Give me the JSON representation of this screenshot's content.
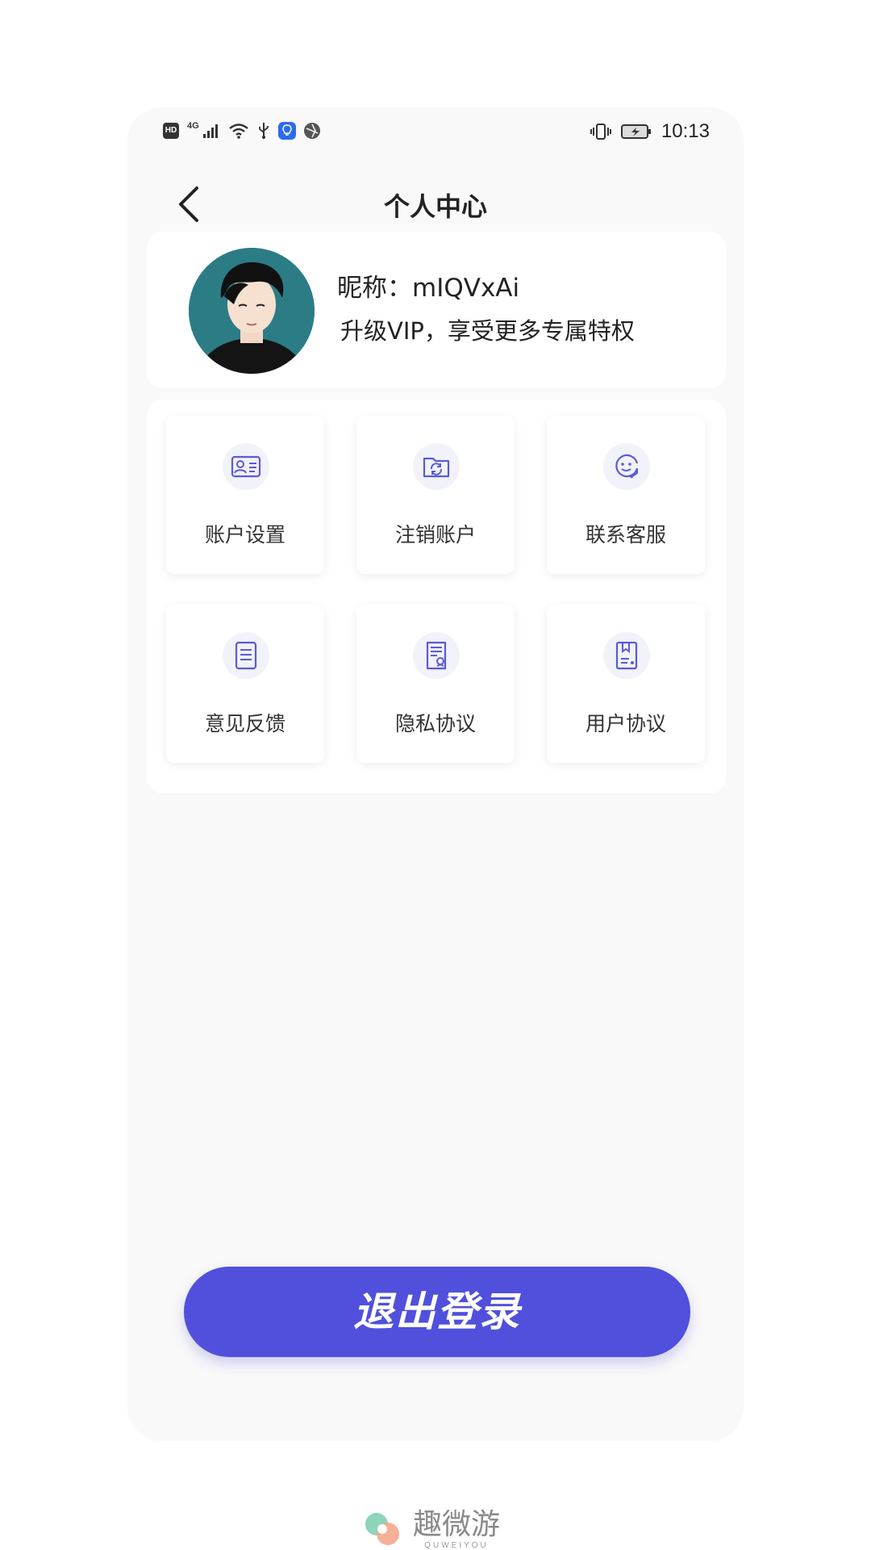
{
  "status_bar": {
    "time": "10:13",
    "hd_label": "HD",
    "network_label": "4G",
    "icons": [
      "hd-icon",
      "signal-icon",
      "wifi-icon",
      "usb-icon",
      "app-notification-icon",
      "globe-icon",
      "vibrate-icon",
      "battery-icon"
    ]
  },
  "header": {
    "title": "个人中心",
    "back_icon": "chevron-left-icon"
  },
  "profile": {
    "nickname": "昵称：mIQVxAi",
    "vip_text": "升级VIP，享受更多专属特权"
  },
  "menu": {
    "items": [
      {
        "label": "账户设置",
        "icon": "id-card-icon"
      },
      {
        "label": "注销账户",
        "icon": "folder-refresh-icon"
      },
      {
        "label": "联系客服",
        "icon": "headset-icon"
      },
      {
        "label": "意见反馈",
        "icon": "document-icon"
      },
      {
        "label": "隐私协议",
        "icon": "privacy-document-icon"
      },
      {
        "label": "用户协议",
        "icon": "bookmark-document-icon"
      }
    ]
  },
  "logout": {
    "label": "退出登录"
  },
  "watermark": {
    "name": "趣微游",
    "sub": "QUWEIYOU"
  },
  "colors": {
    "accent": "#5050dc",
    "icon_stroke": "#5a5ad8",
    "icon_bg": "#f2f2fb",
    "background": "#f9f9f9"
  }
}
